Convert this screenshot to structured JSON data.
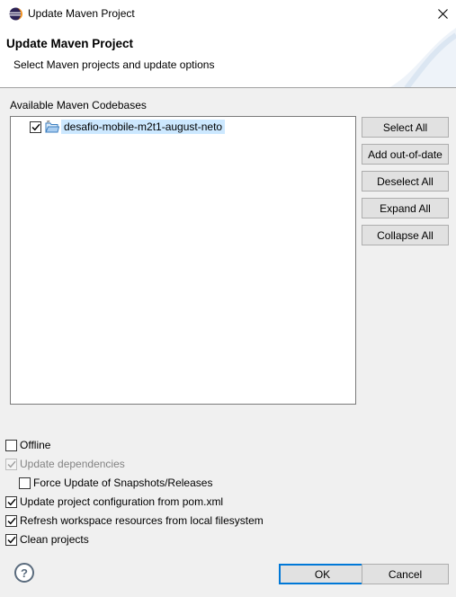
{
  "window": {
    "title": "Update Maven Project",
    "close_icon": "close-icon",
    "app_icon": "eclipse-icon"
  },
  "header": {
    "title": "Update Maven Project",
    "description": "Select Maven projects and update options"
  },
  "codebases": {
    "label": "Available Maven Codebases",
    "items": [
      {
        "label": "desafio-mobile-m2t1-august-neto",
        "checked": true,
        "icon": "maven-project-folder-icon"
      }
    ]
  },
  "side_buttons": {
    "select_all": "Select All",
    "add_out_of_date": "Add out-of-date",
    "deselect_all": "Deselect All",
    "expand_all": "Expand All",
    "collapse_all": "Collapse All"
  },
  "options": [
    {
      "label": "Offline",
      "checked": false,
      "enabled": true
    },
    {
      "label": "Update dependencies",
      "checked": true,
      "enabled": false
    },
    {
      "label": "Force Update of Snapshots/Releases",
      "checked": false,
      "enabled": true
    },
    {
      "label": "Update project configuration from pom.xml",
      "checked": true,
      "enabled": true
    },
    {
      "label": "Refresh workspace resources from local filesystem",
      "checked": true,
      "enabled": true
    },
    {
      "label": "Clean projects",
      "checked": true,
      "enabled": true
    }
  ],
  "footer": {
    "help_glyph": "?",
    "ok": "OK",
    "cancel": "Cancel"
  },
  "colors": {
    "selection": "#cce8ff",
    "primary_border": "#0078d7",
    "button_face": "#e1e1e1",
    "dialog_bg": "#f0f0f0"
  }
}
